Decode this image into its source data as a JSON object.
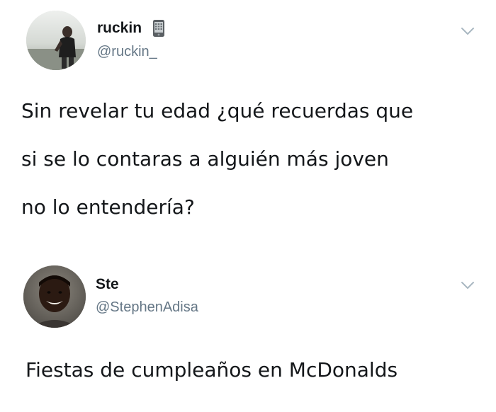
{
  "tweets": [
    {
      "display_name": "ruckin",
      "name_emoji": "mobile-phone-icon",
      "handle": "@ruckin_",
      "text_lines": [
        "Sin revelar tu edad ¿qué recuerdas que",
        "si se lo contaras a alguién más joven",
        "no lo entendería?"
      ],
      "menu_icon": "chevron-down-icon"
    },
    {
      "display_name": "Ste",
      "handle": "@StephenAdisa",
      "text_lines": [
        "Fiestas de cumpleaños en McDonalds"
      ],
      "menu_icon": "chevron-down-icon"
    }
  ],
  "colors": {
    "text": "#14171a",
    "handle": "#657786",
    "chevron": "#aab8c2",
    "background": "#ffffff"
  }
}
